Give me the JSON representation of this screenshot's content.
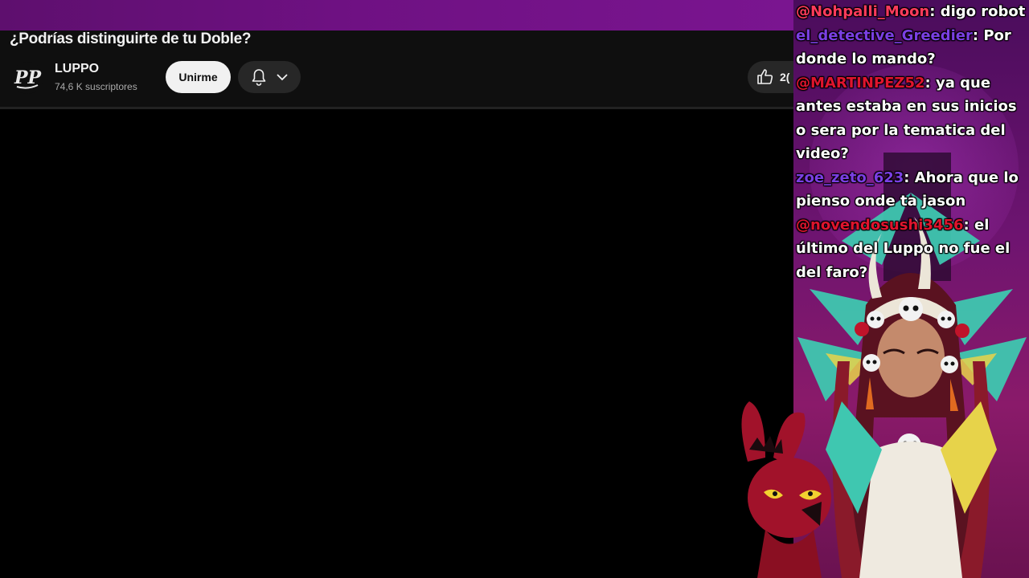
{
  "video": {
    "title": "¿Podrías distinguirte de tu Doble?",
    "channel_name": "LUPPO",
    "subscribers": "74,6 K suscriptores",
    "join_label": "Unirme",
    "like_count": "2("
  },
  "icons": {
    "avatar": "pp-logo-icon",
    "bell": "bell-icon",
    "chevron": "chevron-down-icon",
    "like": "thumbs-up-icon"
  },
  "colors": {
    "stream_bar": "#6f1183",
    "chat_user_pink": "#ff3b5c",
    "chat_user_purple": "#7b3fe4",
    "chat_user_red": "#e0142e"
  },
  "chat": [
    {
      "user": "@Nohpalli_Moon",
      "text": ": digo robot",
      "color": "#ff3b5c"
    },
    {
      "user": "el_detective_Greedier",
      "text": ": Por donde lo mando?",
      "color": "#7b3fe4"
    },
    {
      "user": "@MARTINPEZ52",
      "text": ": ya que antes estaba en sus inicios o sera por la tematica del video?",
      "color": "#e0142e"
    },
    {
      "user": "zoe_zeto_623",
      "text": ": Ahora que lo pienso onde ta jason",
      "color": "#7b3fe4"
    },
    {
      "user": "@novendosushi3456",
      "text": ": el último del Luppo no fue el del faro?",
      "color": "#e0142e"
    }
  ]
}
